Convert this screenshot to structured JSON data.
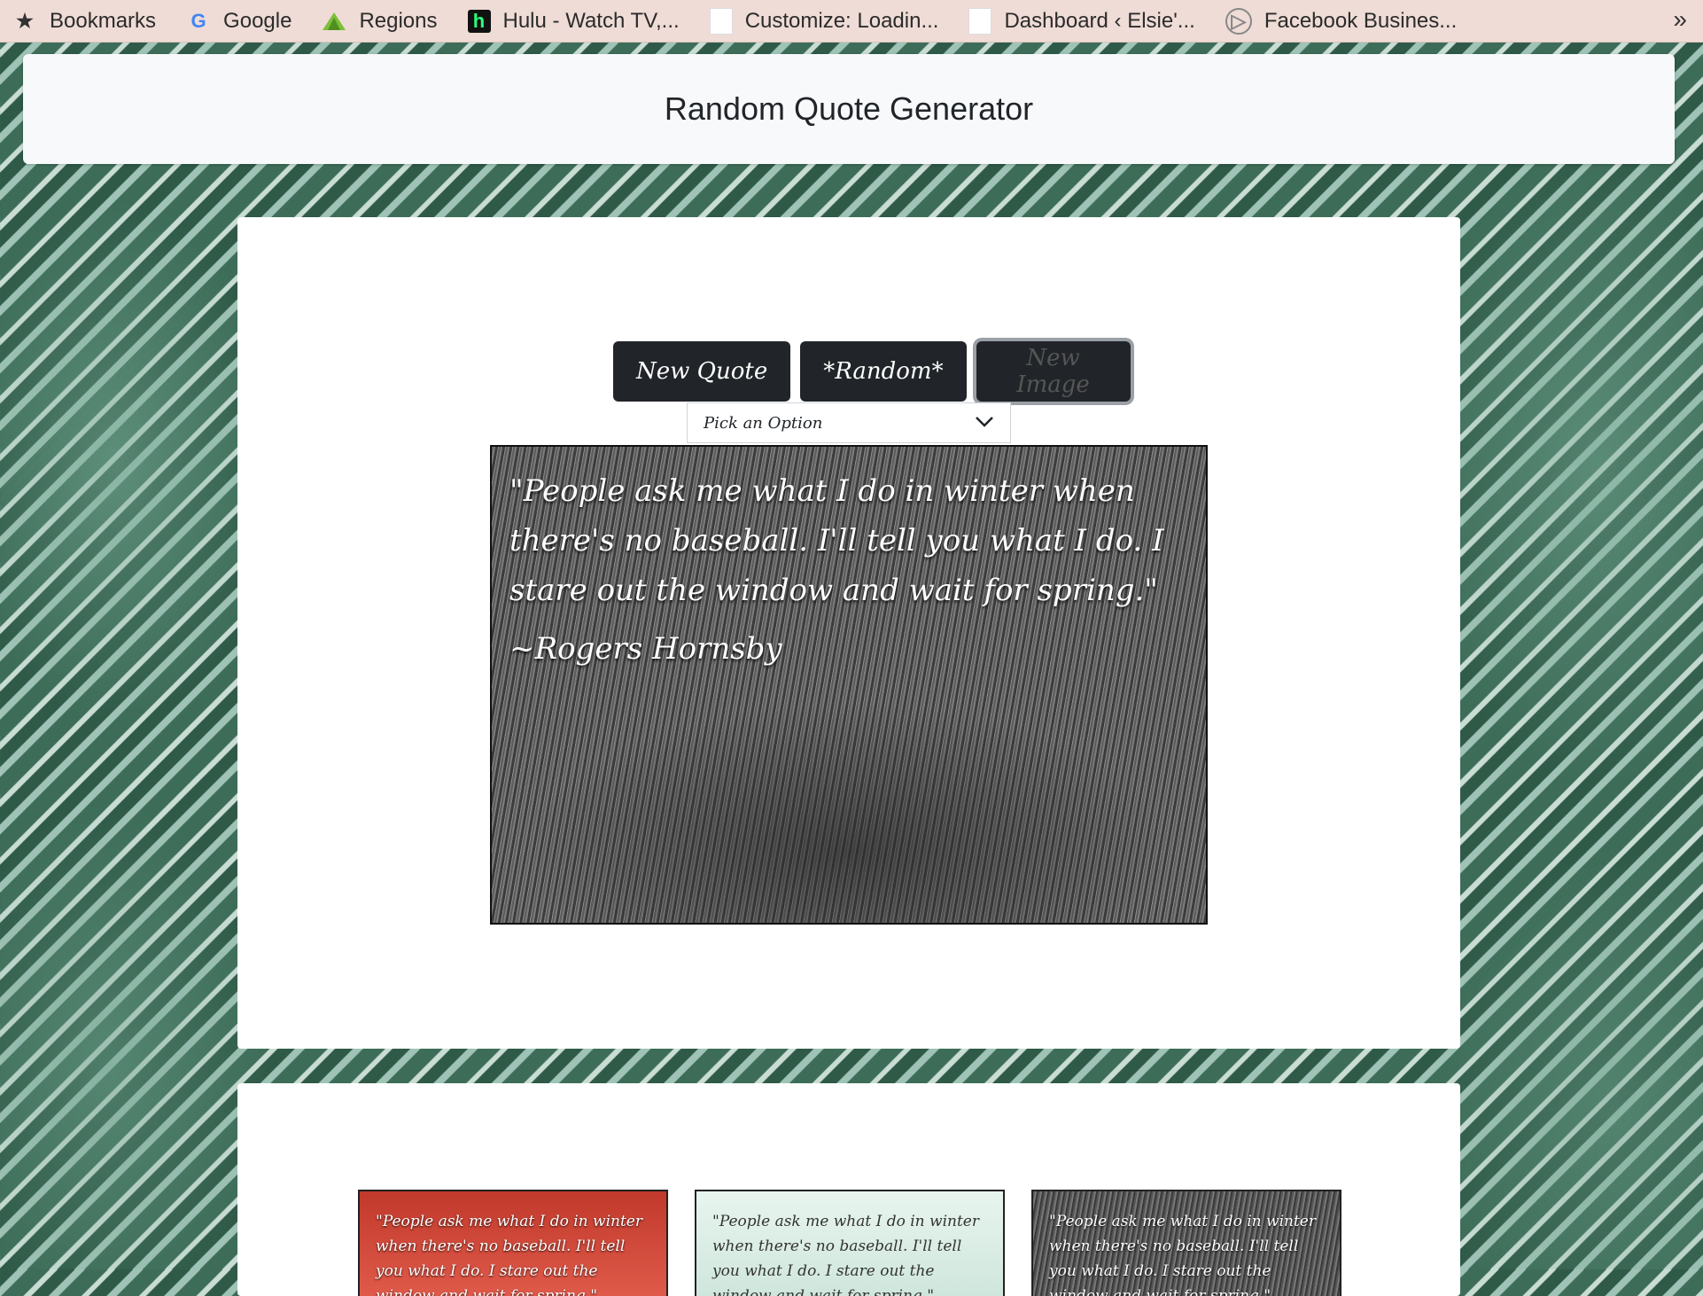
{
  "bookmarks": [
    {
      "label": "Bookmarks",
      "icon": "star-icon"
    },
    {
      "label": "Google",
      "icon": "google-icon"
    },
    {
      "label": "Regions",
      "icon": "regions-icon"
    },
    {
      "label": "Hulu - Watch TV,...",
      "icon": "hulu-icon"
    },
    {
      "label": "Customize: Loadin...",
      "icon": "page-icon"
    },
    {
      "label": "Dashboard ‹ Elsie'...",
      "icon": "page-icon"
    },
    {
      "label": "Facebook Busines...",
      "icon": "facebook-business-icon"
    }
  ],
  "bookmarks_more": "»",
  "navbar": {
    "title": "Random Quote Generator"
  },
  "controls": {
    "new_quote": "New Quote",
    "random": "*Random*",
    "new_image": "New Image",
    "select_value": "Pick an Option"
  },
  "quote": {
    "text": "\"People ask me what I do in winter when there's no baseball. I'll tell you what I do. I stare out the window and wait for spring.\"",
    "author": "~Rogers Hornsby"
  },
  "thumbnails": [
    {
      "text": "\"People ask me what I do in winter when there's no baseball. I'll tell you what I do. I stare out the window and wait for spring.\""
    },
    {
      "text": "\"People ask me what I do in winter when there's no baseball. I'll tell you what I do. I stare out the window and wait for spring.\""
    },
    {
      "text": "\"People ask me what I do in winter when there's no baseball. I'll tell you what I do. I stare out the window and wait for spring.\""
    }
  ]
}
